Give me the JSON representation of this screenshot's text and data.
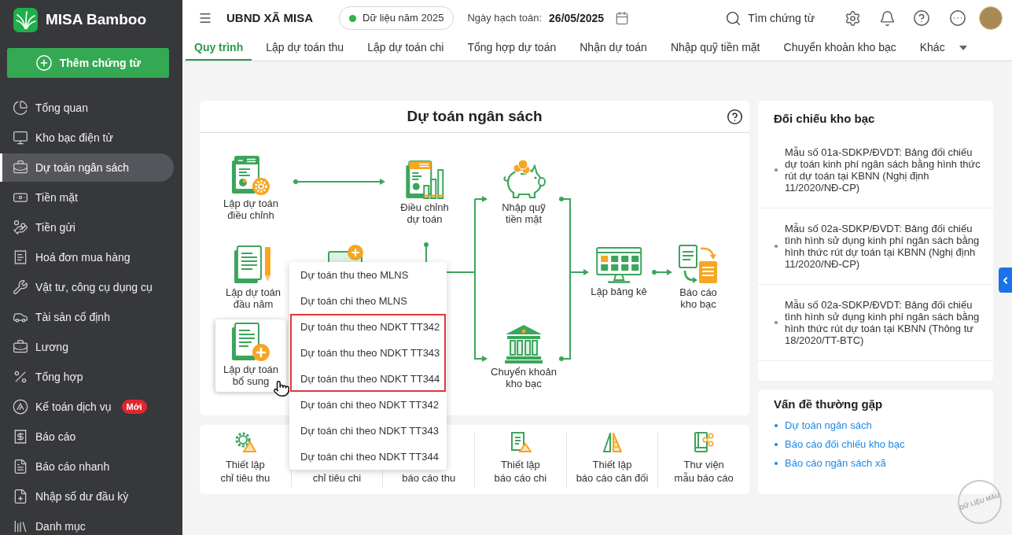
{
  "sidebar": {
    "brand": "MISA Bamboo",
    "add_button": "Thêm chứng từ",
    "items": [
      {
        "label": "Tổng quan",
        "selected": false
      },
      {
        "label": "Kho bạc điện tử",
        "selected": false
      },
      {
        "label": "Dự toán ngân sách",
        "selected": true
      },
      {
        "label": "Tiền mặt",
        "selected": false
      },
      {
        "label": "Tiền gửi",
        "selected": false
      },
      {
        "label": "Hoá đơn mua hàng",
        "selected": false
      },
      {
        "label": "Vật tư, công cụ dụng cụ",
        "selected": false
      },
      {
        "label": "Tài sản cố định",
        "selected": false
      },
      {
        "label": "Lương",
        "selected": false
      },
      {
        "label": "Tổng hợp",
        "selected": false
      },
      {
        "label": "Kế toán dịch vụ",
        "selected": false,
        "badge": "Mới"
      },
      {
        "label": "Báo cáo",
        "selected": false
      },
      {
        "label": "Báo cáo nhanh",
        "selected": false
      },
      {
        "label": "Nhập số dư đầu kỳ",
        "selected": false
      },
      {
        "label": "Danh mục",
        "selected": false
      }
    ]
  },
  "header": {
    "organization": "UBND XÃ MISA",
    "data_year": "Dữ liệu năm 2025",
    "posting_date_label": "Ngày hạch toán:",
    "posting_date": "26/05/2025",
    "search": "Tìm chứng từ"
  },
  "tabs": [
    {
      "label": "Quy trình",
      "selected": true
    },
    {
      "label": "Lập dự toán thu",
      "selected": false
    },
    {
      "label": "Lập dự toán chi",
      "selected": false
    },
    {
      "label": "Tổng hợp dự toán",
      "selected": false
    },
    {
      "label": "Nhận dự toán",
      "selected": false
    },
    {
      "label": "Nhập quỹ tiền mặt",
      "selected": false
    },
    {
      "label": "Chuyển khoản kho bạc",
      "selected": false
    },
    {
      "label": "Khác",
      "selected": false
    }
  ],
  "process": {
    "title": "Dự toán ngân sách",
    "nodes": [
      {
        "label": "Lập dự toán\nđiều chỉnh",
        "hovered": false
      },
      {
        "label": "Điều chỉnh\ndự toán",
        "hovered": false
      },
      {
        "label": "Nhập quỹ\ntiền mặt",
        "hovered": false
      },
      {
        "label": "Lập dự toán\nđầu năm",
        "hovered": false
      },
      {
        "label": "Lập bảng kê",
        "hovered": false
      },
      {
        "label": "Báo cáo\nkho bạc",
        "hovered": false
      },
      {
        "label": "Lập dự toán\nbổ sung",
        "hovered": true
      },
      {
        "label": "Chuyển khoản\nkho bạc",
        "hovered": false
      }
    ]
  },
  "menu": {
    "groups": [
      {
        "highlighted": false,
        "items": [
          "Dự toán thu theo MLNS",
          "Dự toán chi theo MLNS"
        ]
      },
      {
        "highlighted": true,
        "items": [
          "Dự toán thu theo NDKT TT342",
          "Dự toán thu theo NDKT TT343",
          "Dự toán thu theo NDKT TT344"
        ]
      },
      {
        "highlighted": false,
        "items": [
          "Dự toán chi theo NDKT TT342",
          "Dự toán chi theo NDKT TT343",
          "Dự toán chi theo NDKT TT344"
        ]
      }
    ]
  },
  "setup": {
    "items": [
      "Thiết lập\nchỉ tiêu thu",
      "chỉ tiêu chi",
      "báo cáo thu",
      "Thiết lập\nbáo cáo chi",
      "Thiết lập\nbáo cáo cân đối",
      "Thư viện\nmẫu báo cáo"
    ]
  },
  "reconciliation": {
    "title": "Đối chiếu kho bạc",
    "items": [
      "Mẫu số 01a-SDKP/ĐVDT: Bảng đối chiếu dự toán kinh phí ngân sách bằng hình thức rút dự toán tại KBNN (Nghị định 11/2020/NĐ-CP)",
      "Mẫu số 02a-SDKP/ĐVDT: Bảng đối chiếu tình hình sử dụng kinh phí ngân sách bằng hình thức rút dự toán tại KBNN (Nghị định 11/2020/NĐ-CP)",
      "Mẫu số 02a-SDKP/ĐVDT: Bảng đối chiếu tình hình sử dụng kinh phí ngân sách bằng hình thức rút dự toán tại KBNN (Thông tư 18/2020/TT-BTC)"
    ]
  },
  "faq": {
    "title": "Vấn đề thường gặp",
    "links": [
      "Dự toán ngân sách",
      "Báo cáo đối chiếu kho bạc",
      "Báo cáo ngân sách xã"
    ]
  },
  "stamp": "DỮ LIỆU MẪU"
}
